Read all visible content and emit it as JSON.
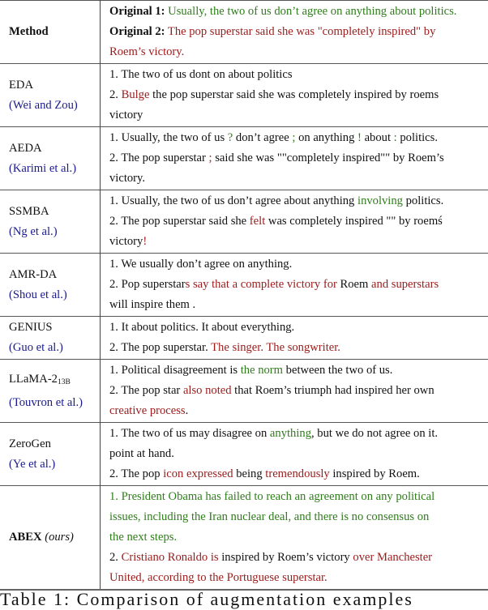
{
  "table": {
    "header": {
      "method_label": "Method",
      "original1_label": "Original 1:",
      "original1_text": " Usually, the two of us don’t agree on anything about politics.",
      "original2_label": "Original 2:",
      "original2_text_a": " The pop superstar said she was \"completely inspired\" by",
      "original2_text_b": "Roem’s victory."
    },
    "colors": {
      "green": "#2e7d1a",
      "red": "#9b1b1b",
      "citation": "#1a1a8c"
    },
    "rows": [
      {
        "method": "EDA",
        "citation": "(Wei and Zou)",
        "ex1": "1. The two of us dont on about politics",
        "ex2_prefix": "2. ",
        "ex2_red": "Bulge",
        "ex2_rest": " the pop superstar said she was completely inspired by roems",
        "ex2_cont": "victory"
      },
      {
        "method": "AEDA",
        "citation": "(Karimi et al.)",
        "ex1_a": "1. Usually, the two of us ",
        "ex1_g1": "?",
        "ex1_b": " don’t agree ",
        "ex1_g2": ";",
        "ex1_c": " on anything ",
        "ex1_g3": "!",
        "ex1_d": " about ",
        "ex1_g4": ":",
        "ex1_e": " politics.",
        "ex2_a": "2. The pop superstar ",
        "ex2_r1": ";",
        "ex2_b": " said she was \"\"completely inspired\"\" by Roem’s",
        "ex2_cont": "victory."
      },
      {
        "method": "SSMBA",
        "citation": "(Ng et al.)",
        "ex1_a": "1. Usually, the two of us don’t agree about anything ",
        "ex1_g": "involving",
        "ex1_b": " politics.",
        "ex2_a": "2. The pop superstar said she ",
        "ex2_r": "felt",
        "ex2_b": " was completely inspired \"\" by roemś",
        "ex2_cont": "victory",
        "ex2_cont_r": "!"
      },
      {
        "method": "AMR-DA",
        "citation": "(Shou et al.)",
        "ex1": "1. We usually don’t agree on anything.",
        "ex2_a": "2. Pop superstar",
        "ex2_r1": "s say that a complete victory for",
        "ex2_b": " Roem ",
        "ex2_r2": "and superstars",
        "ex2_cont": "will inspire them ."
      },
      {
        "method": "GENIUS",
        "citation": "(Guo et al.)",
        "ex1": "1. It about politics. It about everything.",
        "ex2_a": "2. The pop superstar. ",
        "ex2_r": "The singer. The songwriter."
      },
      {
        "method": "LLaMA-2",
        "method_sub": "13B",
        "citation": "(Touvron et al.)",
        "ex1_a": "1. Political disagreement is ",
        "ex1_g": "the norm",
        "ex1_b": " between the two of us.",
        "ex2_a": "2. The pop star ",
        "ex2_r": "also noted",
        "ex2_b": " that Roem’s triumph had inspired her own",
        "ex2_cont_r": "creative process",
        "ex2_cont_end": "."
      },
      {
        "method": "ZeroGen",
        "citation": "(Ye et al.)",
        "ex1_a": "1. The two of us may disagree on ",
        "ex1_g": "anything",
        "ex1_b": ", but we do not agree on it.",
        "ex1_cont": "point at hand.",
        "ex2_a": "2. The pop ",
        "ex2_r1": "icon expressed",
        "ex2_b": " being ",
        "ex2_r2": "tremendously",
        "ex2_c": " inspired by Roem."
      },
      {
        "method": "ABEX",
        "method_note": "(ours)",
        "ex1_l1": "1. President Obama has failed to reach an agreement on any political",
        "ex1_l2": "issues, including the Iran nuclear deal, and there is no consensus on",
        "ex1_l3": "the next steps.",
        "ex2_prefix": "2. ",
        "ex2_r1": "Cristiano Ronaldo is",
        "ex2_b": " inspired by Roem’s victory ",
        "ex2_r2": "over Manchester",
        "ex2_cont_r": "United, according to the Portuguese superstar."
      }
    ]
  },
  "caption": "Table 1:  Comparison of augmentation examples"
}
